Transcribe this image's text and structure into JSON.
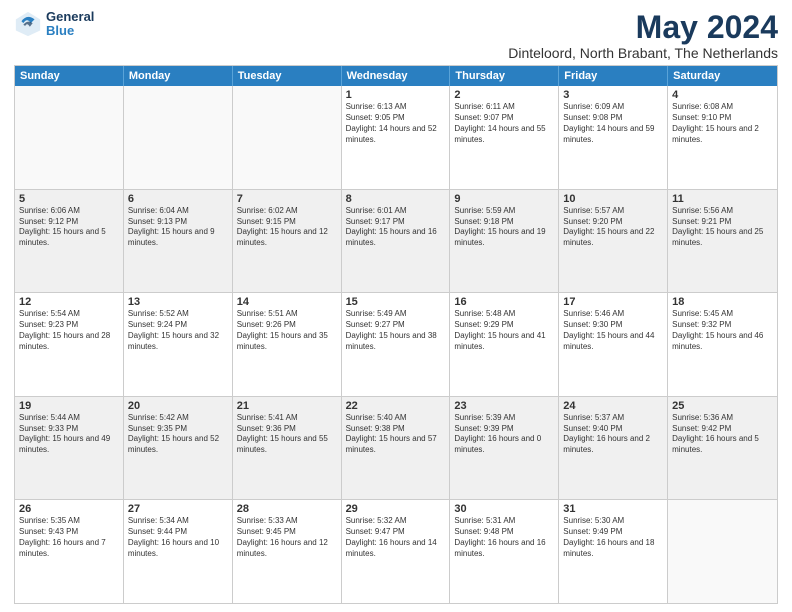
{
  "header": {
    "logo_general": "General",
    "logo_blue": "Blue",
    "month": "May 2024",
    "location": "Dinteloord, North Brabant, The Netherlands"
  },
  "days_of_week": [
    "Sunday",
    "Monday",
    "Tuesday",
    "Wednesday",
    "Thursday",
    "Friday",
    "Saturday"
  ],
  "weeks": [
    [
      {
        "day": "",
        "info": "",
        "empty": true
      },
      {
        "day": "",
        "info": "",
        "empty": true
      },
      {
        "day": "",
        "info": "",
        "empty": true
      },
      {
        "day": "1",
        "info": "Sunrise: 6:13 AM\nSunset: 9:05 PM\nDaylight: 14 hours and 52 minutes."
      },
      {
        "day": "2",
        "info": "Sunrise: 6:11 AM\nSunset: 9:07 PM\nDaylight: 14 hours and 55 minutes."
      },
      {
        "day": "3",
        "info": "Sunrise: 6:09 AM\nSunset: 9:08 PM\nDaylight: 14 hours and 59 minutes."
      },
      {
        "day": "4",
        "info": "Sunrise: 6:08 AM\nSunset: 9:10 PM\nDaylight: 15 hours and 2 minutes."
      }
    ],
    [
      {
        "day": "5",
        "info": "Sunrise: 6:06 AM\nSunset: 9:12 PM\nDaylight: 15 hours and 5 minutes."
      },
      {
        "day": "6",
        "info": "Sunrise: 6:04 AM\nSunset: 9:13 PM\nDaylight: 15 hours and 9 minutes."
      },
      {
        "day": "7",
        "info": "Sunrise: 6:02 AM\nSunset: 9:15 PM\nDaylight: 15 hours and 12 minutes."
      },
      {
        "day": "8",
        "info": "Sunrise: 6:01 AM\nSunset: 9:17 PM\nDaylight: 15 hours and 16 minutes."
      },
      {
        "day": "9",
        "info": "Sunrise: 5:59 AM\nSunset: 9:18 PM\nDaylight: 15 hours and 19 minutes."
      },
      {
        "day": "10",
        "info": "Sunrise: 5:57 AM\nSunset: 9:20 PM\nDaylight: 15 hours and 22 minutes."
      },
      {
        "day": "11",
        "info": "Sunrise: 5:56 AM\nSunset: 9:21 PM\nDaylight: 15 hours and 25 minutes."
      }
    ],
    [
      {
        "day": "12",
        "info": "Sunrise: 5:54 AM\nSunset: 9:23 PM\nDaylight: 15 hours and 28 minutes."
      },
      {
        "day": "13",
        "info": "Sunrise: 5:52 AM\nSunset: 9:24 PM\nDaylight: 15 hours and 32 minutes."
      },
      {
        "day": "14",
        "info": "Sunrise: 5:51 AM\nSunset: 9:26 PM\nDaylight: 15 hours and 35 minutes."
      },
      {
        "day": "15",
        "info": "Sunrise: 5:49 AM\nSunset: 9:27 PM\nDaylight: 15 hours and 38 minutes."
      },
      {
        "day": "16",
        "info": "Sunrise: 5:48 AM\nSunset: 9:29 PM\nDaylight: 15 hours and 41 minutes."
      },
      {
        "day": "17",
        "info": "Sunrise: 5:46 AM\nSunset: 9:30 PM\nDaylight: 15 hours and 44 minutes."
      },
      {
        "day": "18",
        "info": "Sunrise: 5:45 AM\nSunset: 9:32 PM\nDaylight: 15 hours and 46 minutes."
      }
    ],
    [
      {
        "day": "19",
        "info": "Sunrise: 5:44 AM\nSunset: 9:33 PM\nDaylight: 15 hours and 49 minutes."
      },
      {
        "day": "20",
        "info": "Sunrise: 5:42 AM\nSunset: 9:35 PM\nDaylight: 15 hours and 52 minutes."
      },
      {
        "day": "21",
        "info": "Sunrise: 5:41 AM\nSunset: 9:36 PM\nDaylight: 15 hours and 55 minutes."
      },
      {
        "day": "22",
        "info": "Sunrise: 5:40 AM\nSunset: 9:38 PM\nDaylight: 15 hours and 57 minutes."
      },
      {
        "day": "23",
        "info": "Sunrise: 5:39 AM\nSunset: 9:39 PM\nDaylight: 16 hours and 0 minutes."
      },
      {
        "day": "24",
        "info": "Sunrise: 5:37 AM\nSunset: 9:40 PM\nDaylight: 16 hours and 2 minutes."
      },
      {
        "day": "25",
        "info": "Sunrise: 5:36 AM\nSunset: 9:42 PM\nDaylight: 16 hours and 5 minutes."
      }
    ],
    [
      {
        "day": "26",
        "info": "Sunrise: 5:35 AM\nSunset: 9:43 PM\nDaylight: 16 hours and 7 minutes."
      },
      {
        "day": "27",
        "info": "Sunrise: 5:34 AM\nSunset: 9:44 PM\nDaylight: 16 hours and 10 minutes."
      },
      {
        "day": "28",
        "info": "Sunrise: 5:33 AM\nSunset: 9:45 PM\nDaylight: 16 hours and 12 minutes."
      },
      {
        "day": "29",
        "info": "Sunrise: 5:32 AM\nSunset: 9:47 PM\nDaylight: 16 hours and 14 minutes."
      },
      {
        "day": "30",
        "info": "Sunrise: 5:31 AM\nSunset: 9:48 PM\nDaylight: 16 hours and 16 minutes."
      },
      {
        "day": "31",
        "info": "Sunrise: 5:30 AM\nSunset: 9:49 PM\nDaylight: 16 hours and 18 minutes."
      },
      {
        "day": "",
        "info": "",
        "empty": true
      }
    ]
  ]
}
